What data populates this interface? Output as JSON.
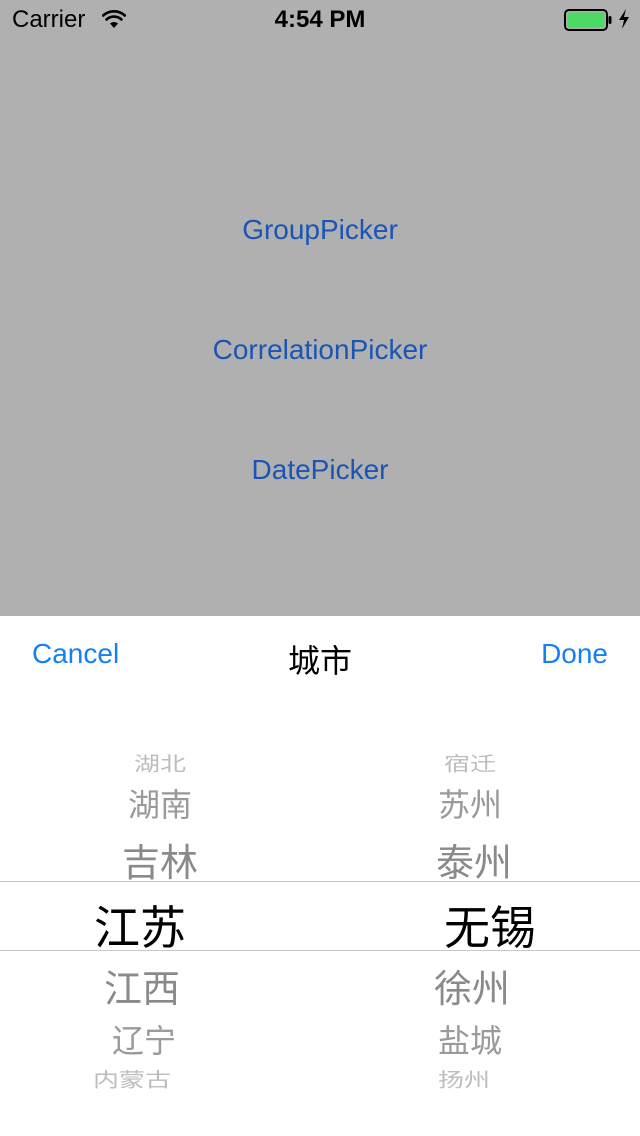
{
  "status_bar": {
    "carrier": "Carrier",
    "time": "4:54 PM",
    "wifi_icon": "wifi-icon",
    "battery_icon": "battery-charging-icon",
    "battery_color": "#4cd964"
  },
  "main": {
    "buttons": [
      "GroupPicker",
      "CorrelationPicker",
      "DatePicker"
    ],
    "background_color": "#b0b0b0",
    "button_color": "#1a55b6"
  },
  "picker_sheet": {
    "cancel_label": "Cancel",
    "title": "城市",
    "done_label": "Done",
    "accent_color": "#1680f2",
    "provinces": {
      "selected": "江苏",
      "items": [
        "湖北",
        "湖南",
        "吉林",
        "江苏",
        "江西",
        "辽宁",
        "内蒙古"
      ]
    },
    "cities": {
      "selected": "无锡",
      "items": [
        "宿迁",
        "苏州",
        "泰州",
        "无锡",
        "徐州",
        "盐城",
        "扬州"
      ]
    }
  }
}
